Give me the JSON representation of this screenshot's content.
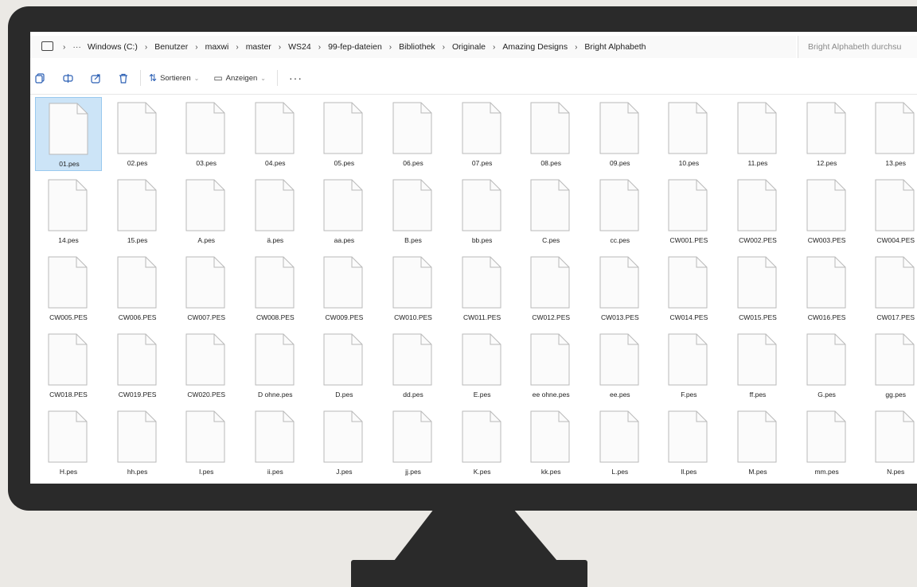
{
  "breadcrumb": [
    "Windows (C:)",
    "Benutzer",
    "maxwi",
    "master",
    "WS24",
    "99-fep-dateien",
    "Bibliothek",
    "Originale",
    "Amazing Designs",
    "Bright Alphabeth"
  ],
  "ellipsis": "···",
  "search": {
    "placeholder": "Bright Alphabeth durchsu"
  },
  "toolbar": {
    "sort_label": "Sortieren",
    "view_label": "Anzeigen",
    "more_label": "···"
  },
  "files": [
    "01.pes",
    "02.pes",
    "03.pes",
    "04.pes",
    "05.pes",
    "06.pes",
    "07.pes",
    "08.pes",
    "09.pes",
    "10.pes",
    "11.pes",
    "12.pes",
    "13.pes",
    "14.pes",
    "15.pes",
    "A.pes",
    "ä.pes",
    "aa.pes",
    "B.pes",
    "bb.pes",
    "C.pes",
    "cc.pes",
    "CW001.PES",
    "CW002.PES",
    "CW003.PES",
    "CW004.PES",
    "CW005.PES",
    "CW006.PES",
    "CW007.PES",
    "CW008.PES",
    "CW009.PES",
    "CW010.PES",
    "CW011.PES",
    "CW012.PES",
    "CW013.PES",
    "CW014.PES",
    "CW015.PES",
    "CW016.PES",
    "CW017.PES",
    "CW018.PES",
    "CW019.PES",
    "CW020.PES",
    "D ohne.pes",
    "D.pes",
    "dd.pes",
    "E.pes",
    "ee ohne.pes",
    "ee.pes",
    "F.pes",
    "ff.pes",
    "G.pes",
    "gg.pes",
    "H.pes",
    "hh.pes",
    "I.pes",
    "ii.pes",
    "J.pes",
    "jj.pes",
    "K.pes",
    "kk.pes",
    "L.pes",
    "ll.pes",
    "M.pes",
    "mm.pes",
    "N.pes"
  ],
  "selected_file": "01.pes",
  "colors": {
    "bezel": "#2a2a2a",
    "selection": "#cce4f7",
    "accent": "#2b5fb4",
    "background": "#ebe9e5"
  }
}
